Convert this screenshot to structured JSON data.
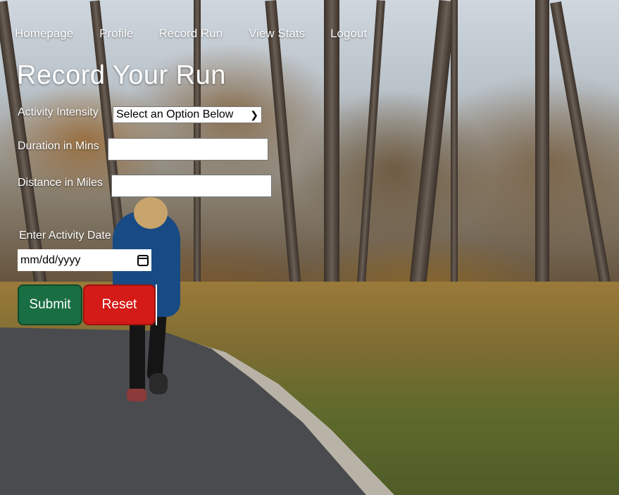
{
  "nav": {
    "items": [
      "Homepage",
      "Profile",
      "Record Run",
      "View Stats",
      "Logout"
    ]
  },
  "page": {
    "title": "Record Your Run"
  },
  "form": {
    "intensity_label": "Activity Intensity",
    "intensity_selected": "Select an Option Below",
    "duration_label": "Duration in Mins",
    "duration_value": "",
    "distance_label": "Distance in Miles",
    "distance_value": "",
    "date_label": "Enter Activity Date",
    "date_placeholder": "mm/dd/yyyy",
    "submit_label": "Submit",
    "reset_label": "Reset"
  },
  "colors": {
    "submit": "#1a6e43",
    "reset": "#d41b17",
    "text": "#ffffff"
  },
  "icons": {
    "select": "chevron-down-icon",
    "date": "calendar-icon"
  }
}
